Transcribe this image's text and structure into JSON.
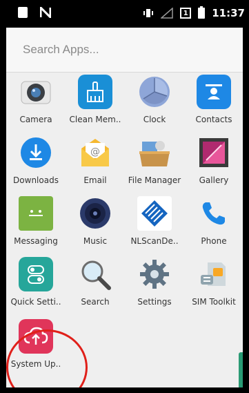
{
  "status_bar": {
    "time": "11:37",
    "sim_label": "1"
  },
  "search": {
    "placeholder": "Search Apps..."
  },
  "apps": [
    {
      "label": "Camera",
      "icon": "camera-icon"
    },
    {
      "label": "Clean Mem..",
      "icon": "broom-icon"
    },
    {
      "label": "Clock",
      "icon": "clock-icon"
    },
    {
      "label": "Contacts",
      "icon": "contacts-icon"
    },
    {
      "label": "Downloads",
      "icon": "download-icon"
    },
    {
      "label": "Email",
      "icon": "email-icon"
    },
    {
      "label": "File Manager",
      "icon": "folder-icon"
    },
    {
      "label": "Gallery",
      "icon": "gallery-icon"
    },
    {
      "label": "Messaging",
      "icon": "chat-icon"
    },
    {
      "label": "Music",
      "icon": "speaker-icon"
    },
    {
      "label": "NLScanDe..",
      "icon": "nlscan-icon"
    },
    {
      "label": "Phone",
      "icon": "phone-icon"
    },
    {
      "label": "Quick Setti..",
      "icon": "toggle-icon"
    },
    {
      "label": "Search",
      "icon": "magnifier-icon"
    },
    {
      "label": "Settings",
      "icon": "gear-icon"
    },
    {
      "label": "SIM Toolkit",
      "icon": "sim-card-icon"
    },
    {
      "label": "System Up..",
      "icon": "cloud-upload-icon"
    }
  ],
  "colors": {
    "highlight": "#e0201a",
    "system_update": "#e0355a"
  }
}
